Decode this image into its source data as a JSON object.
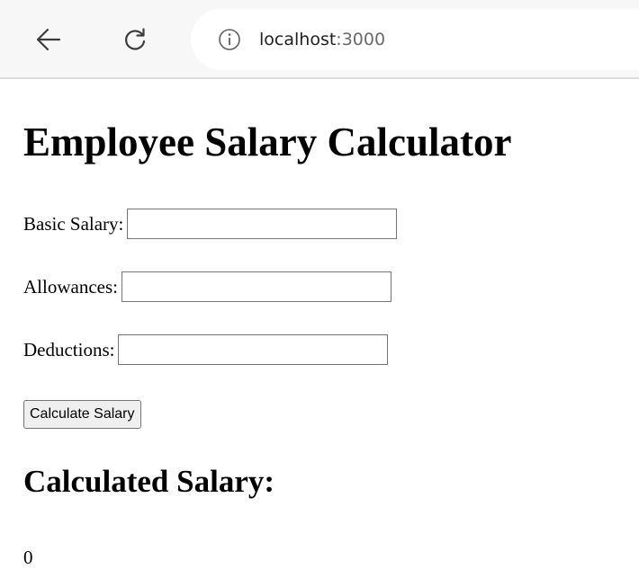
{
  "browser": {
    "url_host": "localhost",
    "url_port": ":3000",
    "icons": {
      "back": "arrow-left-icon",
      "reload": "reload-icon",
      "info": "info-icon"
    }
  },
  "page": {
    "title": "Employee Salary Calculator",
    "fields": [
      {
        "label": "Basic Salary:",
        "value": "",
        "placeholder": ""
      },
      {
        "label": "Allowances:",
        "value": "",
        "placeholder": ""
      },
      {
        "label": "Deductions:",
        "value": "",
        "placeholder": ""
      }
    ],
    "calculate_button_label": "Calculate Salary",
    "result_heading": "Calculated Salary:",
    "result_value": "0"
  },
  "colors": {
    "toolbar_bg": "#f7f7f7",
    "button_bg": "#efefef",
    "input_border": "#767676"
  }
}
